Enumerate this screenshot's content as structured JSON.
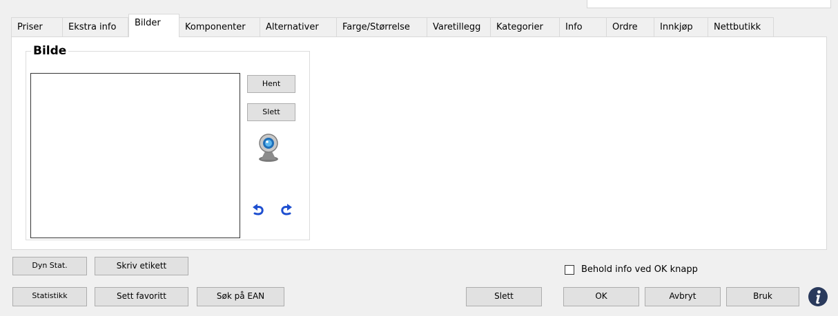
{
  "tabs": [
    {
      "label": "Priser",
      "active": false
    },
    {
      "label": "Ekstra info",
      "active": false
    },
    {
      "label": "Bilder",
      "active": true
    },
    {
      "label": "Komponenter",
      "active": false
    },
    {
      "label": "Alternativer",
      "active": false
    },
    {
      "label": "Farge/Størrelse",
      "active": false
    },
    {
      "label": "Varetillegg",
      "active": false
    },
    {
      "label": "Kategorier",
      "active": false
    },
    {
      "label": "Info",
      "active": false
    },
    {
      "label": "Ordre",
      "active": false
    },
    {
      "label": "Innkjøp",
      "active": false
    },
    {
      "label": "Nettbutikk",
      "active": false
    }
  ],
  "image_group": {
    "title": "Bilde",
    "fetch_label": "Hent",
    "delete_label": "Slett",
    "icons": {
      "webcam": "webcam-icon",
      "rotate_left": "rotate-left-icon",
      "rotate_right": "rotate-right-icon"
    }
  },
  "footer": {
    "dyn_stat": "Dyn Stat.",
    "print_label": "Skriv etikett",
    "statistics": "Statistikk",
    "set_favorite": "Sett favoritt",
    "search_ean": "Søk på EAN",
    "delete": "Slett",
    "keep_info_label": "Behold info ved OK knapp",
    "keep_info_checked": false,
    "ok": "OK",
    "cancel": "Avbryt",
    "apply": "Bruk",
    "info_icon": "info-icon"
  },
  "colors": {
    "rotate_arrow": "#1e4fd0",
    "info_icon": "#2a3a5c",
    "panel_bg": "#ffffff",
    "window_bg": "#f0f0f0"
  }
}
